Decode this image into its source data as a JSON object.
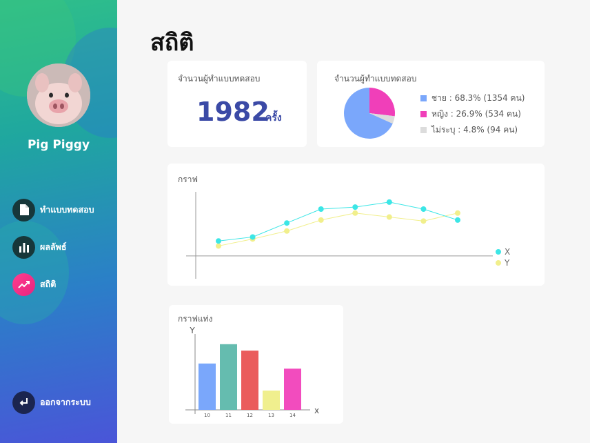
{
  "sidebar": {
    "profile_name": "Pig Piggy",
    "nav": [
      {
        "label": "ทำแบบทดสอบ",
        "icon": "document-icon"
      },
      {
        "label": "ผลลัพธ์",
        "icon": "bar-chart-icon"
      },
      {
        "label": "สถิติ",
        "icon": "trending-up-icon",
        "active": true
      }
    ],
    "logout_label": "ออกจากระบบ"
  },
  "main": {
    "title": "สถิติ",
    "count_card": {
      "title": "จำนวนผู้ทำแบบทดสอบ",
      "value": "1982",
      "unit": "ครั้ง"
    },
    "pie_card": {
      "title": "จำนวนผู้ทำแบบทดสอบ"
    },
    "line_card": {
      "title": "กราฟ"
    },
    "bar_card": {
      "title": "กราฟแท่ง"
    }
  },
  "colors": {
    "male": "#7aa7fb",
    "female": "#f03fb9",
    "unspecified": "#dcdcdc",
    "series_x": "#3ce6e6",
    "series_y": "#f1ef8c",
    "accent": "#3b4aa6"
  },
  "chart_data": [
    {
      "type": "pie",
      "labels": [
        "ชาย : 68.3% (1354 คน)",
        "หญิง : 26.9% (534 คน)",
        "ไม่ระบุ : 4.8% (94 คน)"
      ],
      "values": [
        68.3,
        26.9,
        4.8
      ],
      "colors": [
        "#7aa7fb",
        "#f03fb9",
        "#dcdcdc"
      ]
    },
    {
      "type": "line",
      "x": [
        1,
        2,
        3,
        4,
        5,
        6,
        7,
        8
      ],
      "series": [
        {
          "name": "X",
          "values": [
            1.5,
            1.9,
            3.3,
            4.7,
            4.9,
            5.4,
            4.7,
            3.6
          ]
        },
        {
          "name": "Y",
          "values": [
            1.0,
            1.7,
            2.5,
            3.6,
            4.3,
            3.9,
            3.5,
            4.3
          ]
        }
      ],
      "ylim": [
        -2.5,
        6.5
      ],
      "legend": "right"
    },
    {
      "type": "bar",
      "categories": [
        "10",
        "11",
        "12",
        "13",
        "14"
      ],
      "values": [
        72,
        102,
        92,
        30,
        64
      ],
      "colors": [
        "#7aa7fb",
        "#65bcaf",
        "#ea5c5c",
        "#f0ef8e",
        "#f24cbe"
      ],
      "xlabel": "x",
      "ylabel": "Y",
      "ylim": [
        0,
        120
      ]
    }
  ]
}
